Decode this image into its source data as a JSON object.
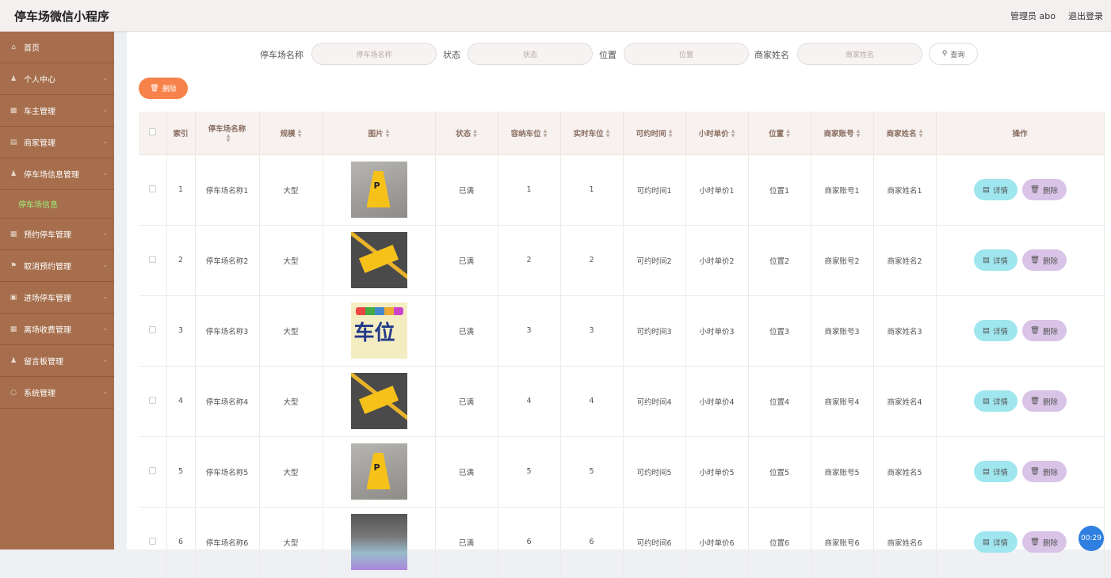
{
  "app": {
    "title": "停车场微信小程序"
  },
  "header": {
    "user_label": "管理员 abo",
    "logout_label": "退出登录"
  },
  "sidebar": {
    "items": [
      {
        "label": "首页",
        "icon": "home-icon"
      },
      {
        "label": "个人中心",
        "icon": "user-icon"
      },
      {
        "label": "车主管理",
        "icon": "car-icon"
      },
      {
        "label": "商家管理",
        "icon": "store-icon"
      },
      {
        "label": "停车场信息管理",
        "icon": "user-icon"
      },
      {
        "label": "预约停车管理",
        "icon": "calendar-icon"
      },
      {
        "label": "取消预约管理",
        "icon": "flag-icon"
      },
      {
        "label": "进场停车管理",
        "icon": "briefcase-icon"
      },
      {
        "label": "离场收费管理",
        "icon": "grid-icon"
      },
      {
        "label": "留言板管理",
        "icon": "user-icon"
      },
      {
        "label": "系统管理",
        "icon": "settings-icon"
      }
    ],
    "active_sub": "停车场信息"
  },
  "search": {
    "name_label": "停车场名称",
    "name_placeholder": "停车场名称",
    "status_label": "状态",
    "status_placeholder": "状态",
    "location_label": "位置",
    "location_placeholder": "位置",
    "merchant_label": "商家姓名",
    "merchant_placeholder": "商家姓名",
    "query_label": "查询"
  },
  "toolbar": {
    "delete_label": "删除"
  },
  "table": {
    "headers": [
      "索引",
      "停车场名称",
      "规模",
      "图片",
      "状态",
      "容纳车位",
      "实时车位",
      "可约时间",
      "小时单价",
      "位置",
      "商家账号",
      "商家姓名",
      "操作"
    ],
    "detail_label": "详情",
    "delete_label": "删除",
    "rows": [
      {
        "index": "1",
        "name": "停车场名称1",
        "scale": "大型",
        "image": "sign",
        "status": "已满",
        "capacity": "1",
        "realtime": "1",
        "time": "可约时间1",
        "price": "小时单价1",
        "location": "位置1",
        "account": "商家账号1",
        "merchant": "商家姓名1"
      },
      {
        "index": "2",
        "name": "停车场名称2",
        "scale": "大型",
        "image": "road",
        "status": "已满",
        "capacity": "2",
        "realtime": "2",
        "time": "可约时间2",
        "price": "小时单价2",
        "location": "位置2",
        "account": "商家账号2",
        "merchant": "商家姓名2"
      },
      {
        "index": "3",
        "name": "停车场名称3",
        "scale": "大型",
        "image": "cars",
        "status": "已满",
        "capacity": "3",
        "realtime": "3",
        "time": "可约时间3",
        "price": "小时单价3",
        "location": "位置3",
        "account": "商家账号3",
        "merchant": "商家姓名3"
      },
      {
        "index": "4",
        "name": "停车场名称4",
        "scale": "大型",
        "image": "road",
        "status": "已满",
        "capacity": "4",
        "realtime": "4",
        "time": "可约时间4",
        "price": "小时单价4",
        "location": "位置4",
        "account": "商家账号4",
        "merchant": "商家姓名4"
      },
      {
        "index": "5",
        "name": "停车场名称5",
        "scale": "大型",
        "image": "sign",
        "status": "已满",
        "capacity": "5",
        "realtime": "5",
        "time": "可约时间5",
        "price": "小时单价5",
        "location": "位置5",
        "account": "商家账号5",
        "merchant": "商家姓名5"
      },
      {
        "index": "6",
        "name": "停车场名称6",
        "scale": "大型",
        "image": "garage",
        "status": "已满",
        "capacity": "6",
        "realtime": "6",
        "time": "可约时间6",
        "price": "小时单价6",
        "location": "位置6",
        "account": "商家账号6",
        "merchant": "商家姓名6"
      }
    ]
  },
  "timer": "00:29"
}
